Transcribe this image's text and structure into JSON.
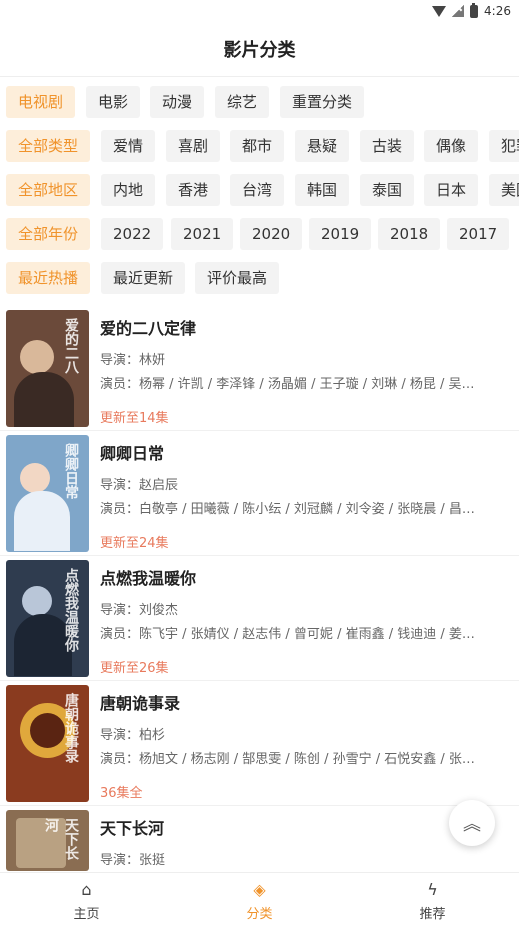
{
  "status": {
    "time": "4:26"
  },
  "header": {
    "title": "影片分类"
  },
  "filters": {
    "category": [
      "电视剧",
      "电影",
      "动漫",
      "综艺",
      "重置分类"
    ],
    "genre": [
      "全部类型",
      "爱情",
      "喜剧",
      "都市",
      "悬疑",
      "古装",
      "偶像",
      "犯罪"
    ],
    "region": [
      "全部地区",
      "内地",
      "香港",
      "台湾",
      "韩国",
      "泰国",
      "日本",
      "美国"
    ],
    "year": [
      "全部年份",
      "2022",
      "2021",
      "2020",
      "2019",
      "2018",
      "2017"
    ],
    "sort": [
      "最近热播",
      "最近更新",
      "评价最高"
    ]
  },
  "movies": [
    {
      "title": "爱的二八定律",
      "director": "导演：林妍",
      "actors": "演员：杨幂 / 许凯 / 李泽锋 / 汤晶媚 / 王子璇 / 刘琳 / 杨昆 / 吴…",
      "update": "更新至14集"
    },
    {
      "title": "卿卿日常",
      "director": "导演：赵启辰",
      "actors": "演员：白敬亭 / 田曦薇 / 陈小纭 / 刘冠麟 / 刘令姿 / 张晓晨 / 昌…",
      "update": "更新至24集"
    },
    {
      "title": "点燃我温暖你",
      "director": "导演：刘俊杰",
      "actors": "演员：陈飞宇 / 张婧仪 / 赵志伟 / 曾可妮 / 崔雨鑫 / 钱迪迪 / 姜…",
      "update": "更新至26集"
    },
    {
      "title": "唐朝诡事录",
      "director": "导演：柏杉",
      "actors": "演员：杨旭文 / 杨志刚 / 郜思雯 / 陈创 / 孙雪宁 / 石悦安鑫 / 张…",
      "update": "36集全"
    },
    {
      "title": "天下长河",
      "director": "导演：张挺",
      "actors": "",
      "update": ""
    }
  ],
  "posters": [
    {
      "bg": "#6b4a3a",
      "accent": "#d9b89a",
      "text": "爱的二八"
    },
    {
      "bg": "#7fa6c9",
      "accent": "#f2d7c4",
      "text": "卿卿日常"
    },
    {
      "bg": "#2f3c4f",
      "accent": "#b9c6d8",
      "text": "点燃我温暖你"
    },
    {
      "bg": "#8a3b1f",
      "accent": "#e0a83c",
      "text": "唐朝诡事录"
    },
    {
      "bg": "#8a6d52",
      "accent": "#d8c4a4",
      "text": "天下长河"
    }
  ],
  "tabs": [
    {
      "label": "主页",
      "icon": "home-icon"
    },
    {
      "label": "分类",
      "icon": "layers-icon"
    },
    {
      "label": "推荐",
      "icon": "bolt-icon"
    }
  ],
  "colors": {
    "accent": "#f0932b",
    "update": "#e87a5d"
  }
}
